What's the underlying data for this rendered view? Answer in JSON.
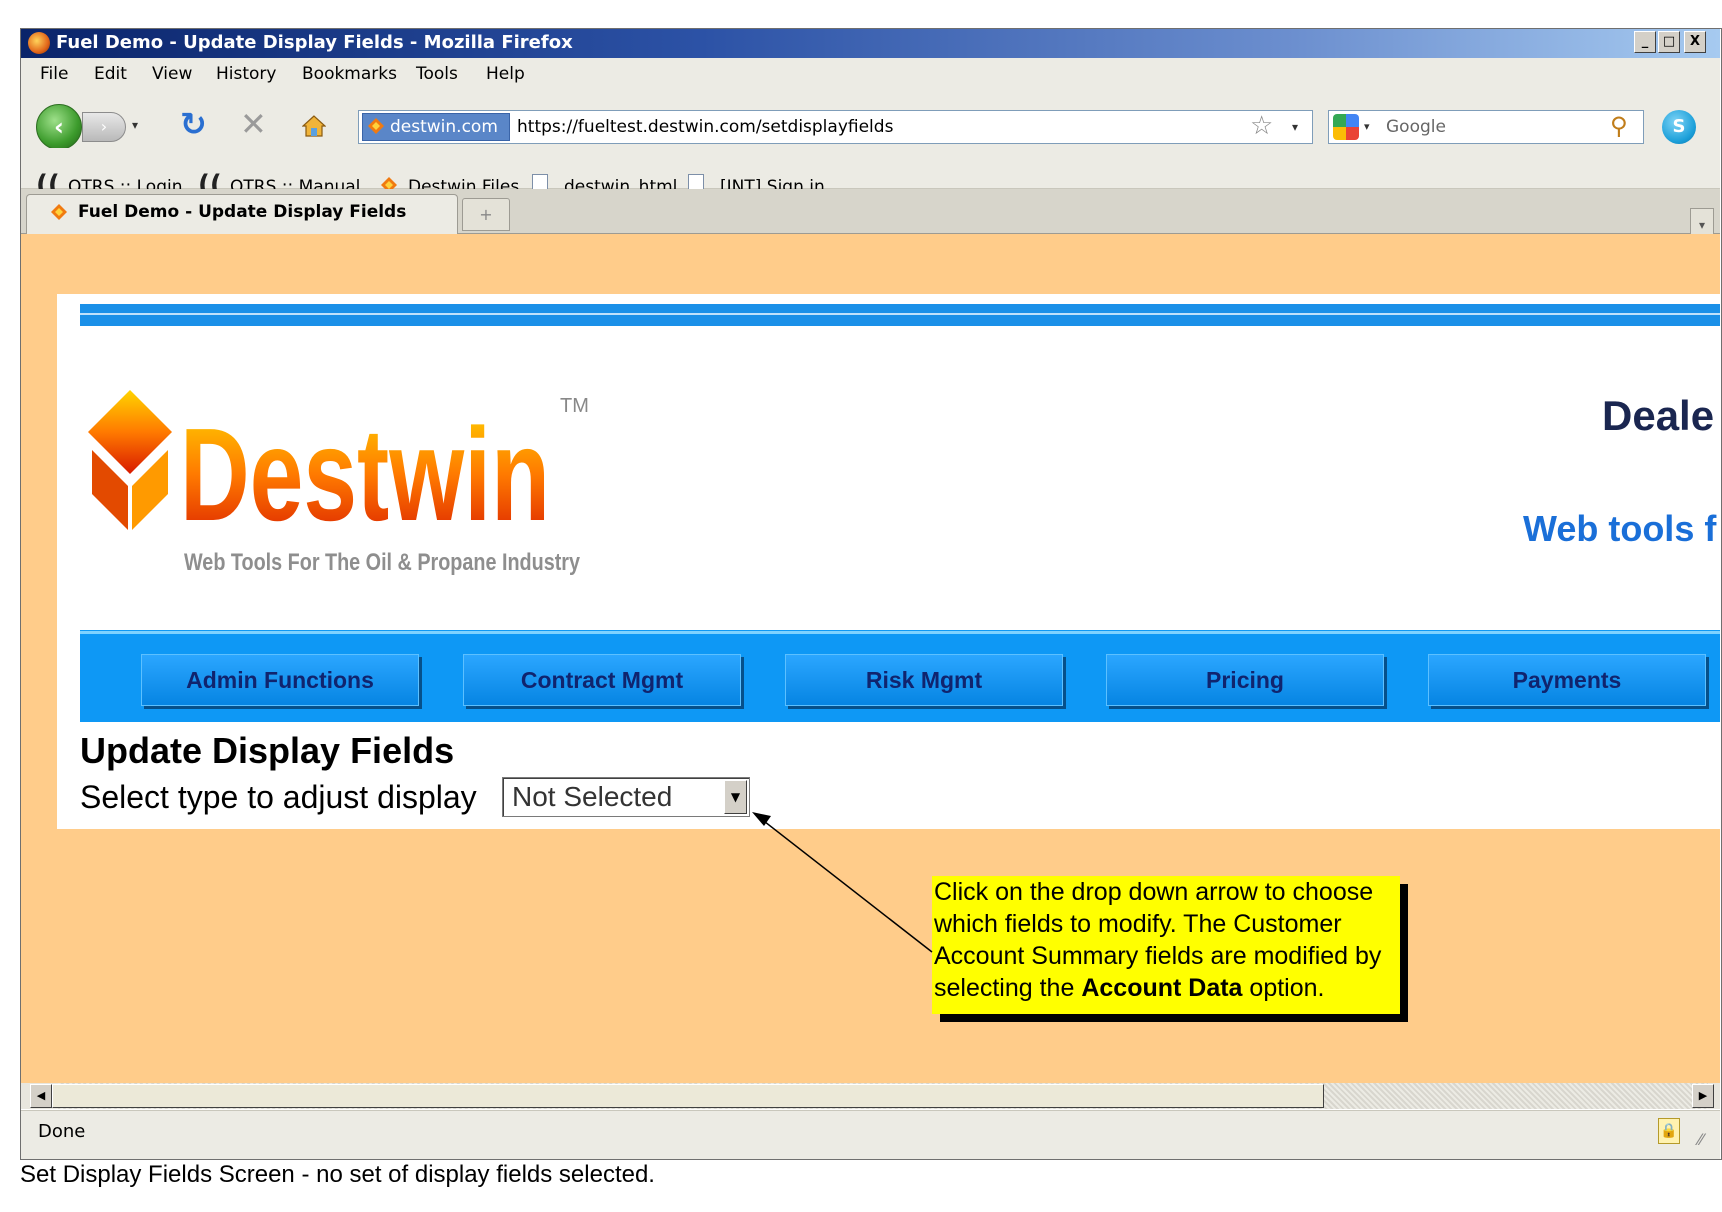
{
  "window": {
    "title": "Fuel Demo - Update Display Fields - Mozilla Firefox",
    "minimize": "_",
    "maximize": "□",
    "close": "X"
  },
  "menu": [
    "File",
    "Edit",
    "View",
    "History",
    "Bookmarks",
    "Tools",
    "Help"
  ],
  "nav": {
    "site_identity": "destwin.com",
    "url": "https://fueltest.destwin.com/setdisplayfields",
    "search_placeholder": "Google"
  },
  "bookmarks": [
    "OTRS :: Login",
    "OTRS :: Manual",
    "Destwin Files",
    "destwin_html",
    "[INT] Sign in"
  ],
  "tab": {
    "label": "Fuel Demo - Update Display Fields"
  },
  "header": {
    "dealer_text": "Deale",
    "tagline_text": "Web tools f",
    "logo_wordmark": "Destwin",
    "logo_tagline": "Web Tools For The Oil & Propane Industry",
    "logo_tm": "TM"
  },
  "navbuttons": [
    "Admin Functions",
    "Contract Mgmt",
    "Risk Mgmt",
    "Pricing",
    "Payments"
  ],
  "main": {
    "heading": "Update Display Fields",
    "select_label": "Select type to adjust display",
    "select_value": "Not Selected"
  },
  "annotation": {
    "text_before": "Click on the drop down arrow to choose which fields to modify. The Customer Account Summary fields are modified by selecting the ",
    "text_bold": "Account Data",
    "text_after": " option."
  },
  "status": {
    "text": "Done"
  },
  "caption": "Set Display Fields Screen - no set of display fields selected.",
  "colors": {
    "page_background": "#ffcc8a",
    "nav_blue": "#0e98f5",
    "callout_yellow": "#ffff00",
    "title_bar": "#0a246a"
  }
}
